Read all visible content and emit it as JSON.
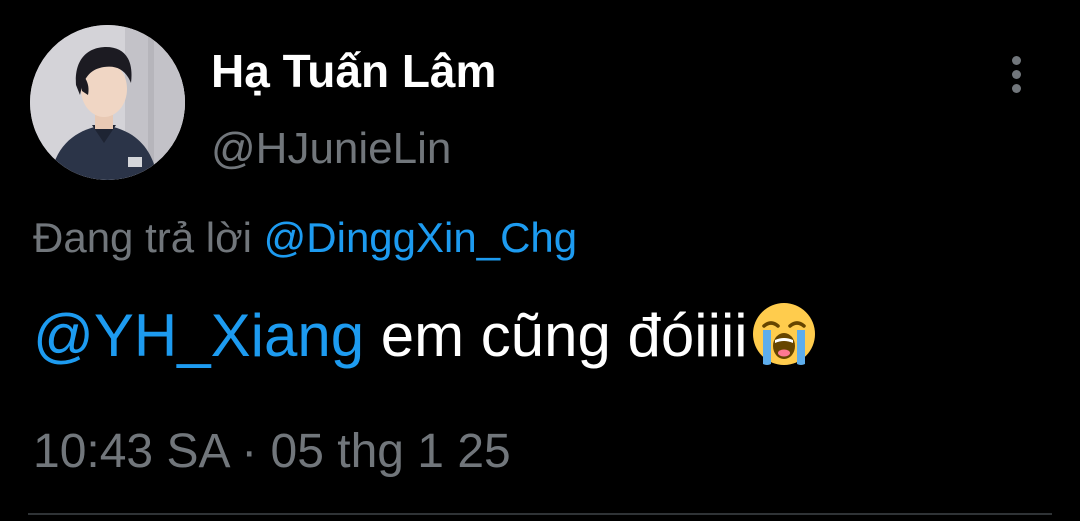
{
  "tweet": {
    "author": {
      "display_name": "Hạ Tuấn Lâm",
      "handle": "@HJunieLin"
    },
    "more_icon": "more-vertical-icon",
    "reply": {
      "prefix": "Đang trả lời",
      "mention": "@DinggXin_Chg"
    },
    "body": {
      "mention": "@YH_Xiang",
      "text": " em cũng đóiiii",
      "emoji": "loudly-crying-face"
    },
    "meta": {
      "time": "10:43 SA",
      "separator": "·",
      "date": "05 thg 1 25"
    }
  },
  "colors": {
    "background": "#000000",
    "primary_text": "#ffffff",
    "secondary_text": "#71767b",
    "link": "#1d9bf0",
    "divider": "#2f3336"
  }
}
